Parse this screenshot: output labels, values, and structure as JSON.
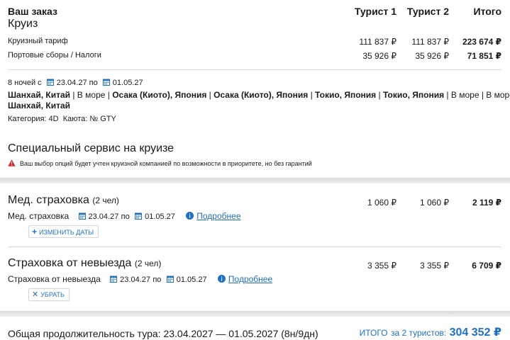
{
  "header": {
    "order_label": "Ваш заказ",
    "cruise_label": "Круиз",
    "col_tourist1": "Турист 1",
    "col_tourist2": "Турист 2",
    "col_total": "Итого"
  },
  "cruise": {
    "rows": [
      {
        "label": "Круизный тариф",
        "t1": "111 837 ₽",
        "t2": "111 837 ₽",
        "total": "223 674 ₽"
      },
      {
        "label": "Портовые сборы / Налоги",
        "t1": "35 926 ₽",
        "t2": "35 926 ₽",
        "total": "71 851 ₽"
      }
    ],
    "nights_prefix": "8 ночей с",
    "date_from": "23.04.27",
    "date_sep": "по",
    "date_to": "01.05.27",
    "route_line1": [
      {
        "text": "Шанхай, Китай",
        "bold": true
      },
      {
        "text": " | В море | ",
        "bold": false
      },
      {
        "text": "Осака (Киото), Япония",
        "bold": true
      },
      {
        "text": " | ",
        "bold": false
      },
      {
        "text": "Осака (Киото), Япония",
        "bold": true
      },
      {
        "text": " | ",
        "bold": false
      },
      {
        "text": "Токио, Япония",
        "bold": true
      },
      {
        "text": " | ",
        "bold": false
      },
      {
        "text": "Токио, Япония",
        "bold": true
      },
      {
        "text": " | В море | В море |",
        "bold": false
      }
    ],
    "route_line2": "Шанхай, Китай",
    "category_label": "Категория:",
    "category_value": "4D",
    "cabin_label": "Каюта:",
    "cabin_value": "№ GTY"
  },
  "special": {
    "title": "Специальный сервис на круизе",
    "warning": "Ваш выбор опций будет учтен круизной компанией по возможности в приоритете, но без гарантий"
  },
  "med": {
    "title": "Мед. страховка",
    "count": "(2 чел)",
    "t1": "1 060 ₽",
    "t2": "1 060 ₽",
    "total": "2 119 ₽",
    "sub_label": "Мед. страховка",
    "date_from": "23.04.27",
    "date_sep": "по",
    "date_to": "01.05.27",
    "more": "Подробнее",
    "button": "Изменить даты"
  },
  "cancel": {
    "title": "Страховка от невыезда",
    "count": "(2 чел)",
    "t1": "3 355 ₽",
    "t2": "3 355 ₽",
    "total": "6 709 ₽",
    "sub_label": "Страховка от невыезда",
    "date_from": "23.04.27",
    "date_sep": "по",
    "date_to": "01.05.27",
    "more": "Подробнее",
    "button": "Убрать"
  },
  "footer": {
    "duration": "Общая продолжительность тура: 23.04.2027 — 01.05.2027 (8н/9дн)",
    "total_label": "ИТОГО",
    "total_for": "за 2 туристов:",
    "total_value": "304 352 ₽"
  },
  "colors": {
    "accent": "#1f6fc5",
    "warning": "#d9252b"
  },
  "icons": {
    "calendar": "calendar-icon",
    "info": "info-icon",
    "warning": "warning-icon",
    "plus": "plus-icon",
    "close": "close-icon"
  }
}
